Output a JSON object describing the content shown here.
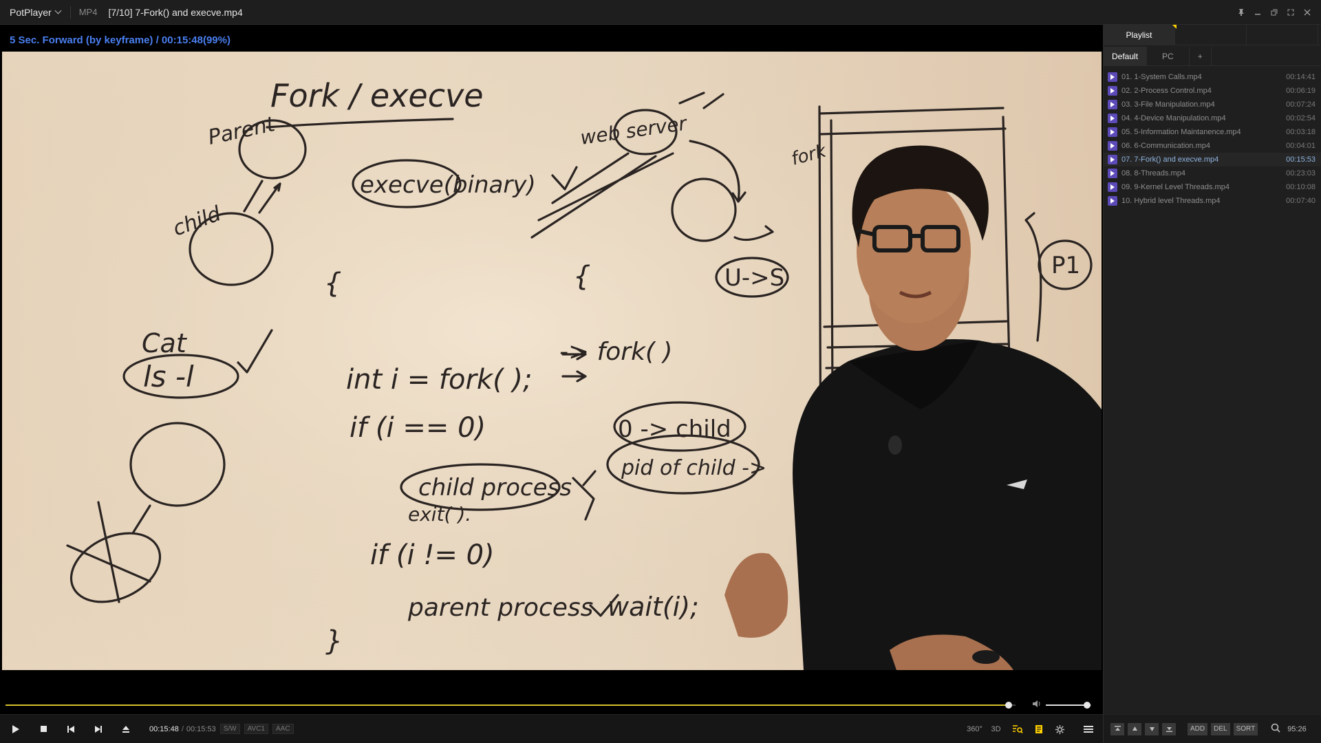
{
  "titlebar": {
    "app_menu": "PotPlayer",
    "format": "MP4",
    "title": "[7/10] 7-Fork() and execve.mp4"
  },
  "osd": {
    "message": "5 Sec. Forward (by keyframe) / 00:15:48(99%)"
  },
  "seek": {
    "progress": 0.993,
    "volume": 0.91
  },
  "controls": {
    "current_time": "00:15:48",
    "separator": "/",
    "total_time": "00:15:53",
    "tags": [
      "S/W",
      "AVC1",
      "AAC"
    ],
    "right_buttons": [
      "360°",
      "3D"
    ]
  },
  "playlist": {
    "tabs": [
      "Playlist"
    ],
    "subtabs": [
      "Default",
      "PC",
      "+"
    ],
    "items": [
      {
        "name": "01. 1-System Calls.mp4",
        "duration": "00:14:41"
      },
      {
        "name": "02. 2-Process Control.mp4",
        "duration": "00:06:19"
      },
      {
        "name": "03. 3-File Manipulation.mp4",
        "duration": "00:07:24"
      },
      {
        "name": "04. 4-Device Manipulation.mp4",
        "duration": "00:02:54"
      },
      {
        "name": "05. 5-Information Maintanence.mp4",
        "duration": "00:03:18"
      },
      {
        "name": "06. 6-Communication.mp4",
        "duration": "00:04:01"
      },
      {
        "name": "07. 7-Fork() and execve.mp4",
        "duration": "00:15:53",
        "current": true
      },
      {
        "name": "08. 8-Threads.mp4",
        "duration": "00:23:03"
      },
      {
        "name": "09. 9-Kernel Level Threads.mp4",
        "duration": "00:10:08"
      },
      {
        "name": "10. Hybrid level Threads.mp4",
        "duration": "00:07:40"
      }
    ],
    "bottom_buttons": [
      "ADD",
      "DEL",
      "SORT"
    ],
    "total": "95:26"
  },
  "whiteboard": {
    "lines": [
      "Fork / execve",
      "Parent",
      "child",
      "Cat",
      "ls -l",
      "execve(binary)",
      "web server",
      "U->S",
      "fork",
      "P1",
      "-> fork( )",
      "int i = fork( );",
      "if (i == 0)",
      "child process",
      "exit( ).",
      "if (i != 0)",
      "parent process",
      "wait(i);",
      "0 -> child",
      "pid of child ->"
    ]
  }
}
